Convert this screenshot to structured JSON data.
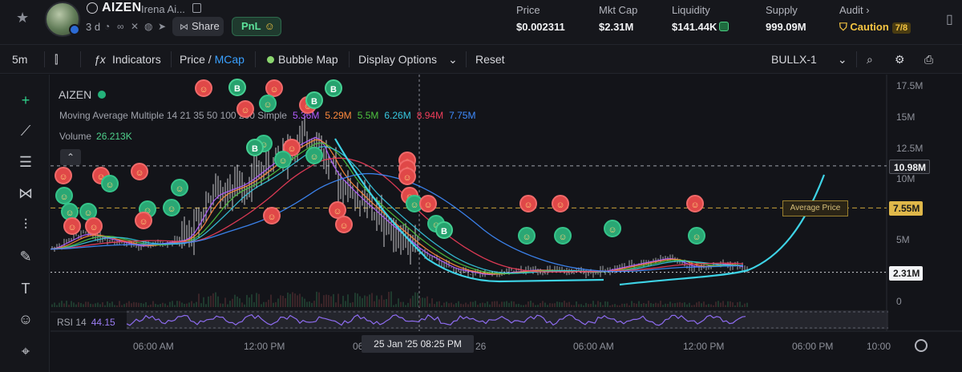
{
  "header": {
    "symbol": "AIZEN",
    "name": "Irena Ai...",
    "age": "3 d",
    "share_label": "Share",
    "pnl_label": "PnL",
    "stats": {
      "price": {
        "label": "Price",
        "value": "$0.002311"
      },
      "mcap": {
        "label": "Mkt Cap",
        "value": "$2.31M"
      },
      "liquidity": {
        "label": "Liquidity",
        "value": "$141.44K"
      },
      "supply": {
        "label": "Supply",
        "value": "999.09M"
      },
      "audit": {
        "label": "Audit",
        "value": "Caution",
        "badge": "7/8"
      }
    }
  },
  "toolbar": {
    "interval": "5m",
    "indicators": "Indicators",
    "price": "Price",
    "mcap": "MCap",
    "bubble_map": "Bubble Map",
    "display_options": "Display Options",
    "reset": "Reset",
    "source": "BULLX-1"
  },
  "chart": {
    "title": "AIZEN",
    "ma_label": "Moving Average Multiple 14 21 35 50 100 200 Simple",
    "ma_values": [
      {
        "value": "5.36M",
        "color": "#b35cff"
      },
      {
        "value": "5.29M",
        "color": "#ff8a3d"
      },
      {
        "value": "5.5M",
        "color": "#4ec23f"
      },
      {
        "value": "6.26M",
        "color": "#37c8e0"
      },
      {
        "value": "8.94M",
        "color": "#ef3d5a"
      },
      {
        "value": "7.75M",
        "color": "#3f8cff"
      }
    ],
    "volume_label": "Volume",
    "volume_value": "26.213K",
    "rsi_label": "RSI 14",
    "rsi_value": "44.15",
    "y_ticks": [
      "17.5M",
      "15M",
      "12.5M",
      "10M",
      "5M",
      "0"
    ],
    "y_high": "10.98M",
    "y_avg": "7.55M",
    "y_current": "2.31M",
    "average_price_tag": "Average Price",
    "x_ticks": [
      "06:00 AM",
      "12:00 PM",
      "06",
      "26",
      "06:00 AM",
      "12:00 PM",
      "06:00 PM",
      "10:00"
    ],
    "crosshair": "25 Jan '25   08:25 PM"
  },
  "chart_data": {
    "type": "line",
    "ylabel": "Market Cap",
    "ylim": [
      0,
      17.5
    ],
    "y_units": "M",
    "series": [
      {
        "name": "MCap",
        "x": [
          "06:00 AM",
          "12:00 PM",
          "06:00 PM",
          "26",
          "06:00 AM",
          "12:00 PM"
        ],
        "values": [
          5.0,
          10.5,
          12.0,
          4.0,
          2.5,
          3.0
        ]
      }
    ],
    "reference_lines": {
      "high": 10.98,
      "average_price": 7.55,
      "current": 2.31
    }
  },
  "colors": {
    "background": "#131419",
    "accent_green": "#5ce29b",
    "accent_blue": "#3aa0ff",
    "caution": "#f5c542",
    "freehand": "#3ed3e6"
  }
}
